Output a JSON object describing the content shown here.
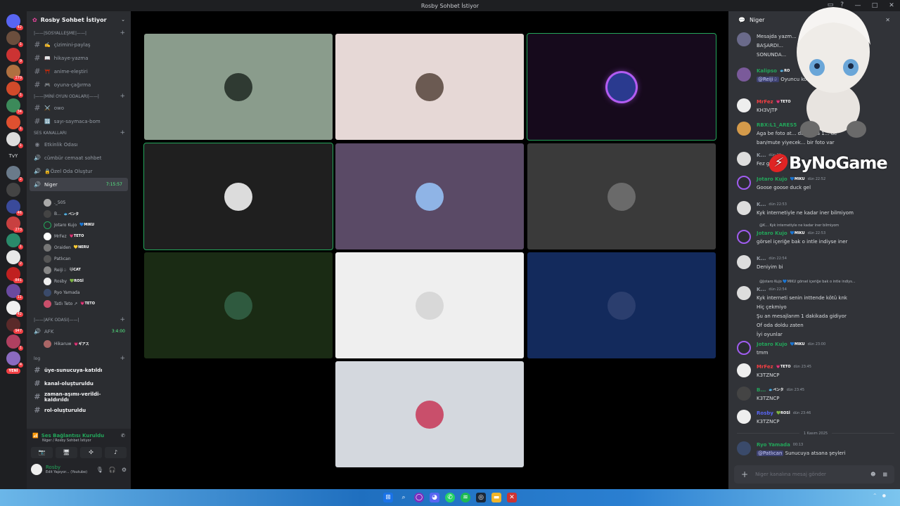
{
  "window": {
    "title": "Rosby Sohbet İstiyor",
    "controls": [
      "—",
      "□",
      "✕"
    ]
  },
  "rail": {
    "top_badge": "42",
    "new_badge": "YENİ",
    "text_server": "TvY",
    "badges": [
      "1",
      "9",
      "279",
      "1",
      "34",
      "1",
      "1",
      "2",
      "46",
      "273",
      "1",
      "2",
      "841",
      "11",
      "42",
      "947",
      "1",
      "4"
    ]
  },
  "guild": {
    "name": "Rosby Sohbet İstiyor"
  },
  "sidebar": {
    "cat1": "|——|SOSYALLEŞME|——|",
    "text_channels": [
      {
        "icon": "✍️",
        "label": "çizimini-paylaş"
      },
      {
        "icon": "📖",
        "label": "hikaye-yazma"
      },
      {
        "icon": "⛩️",
        "label": "anime-eleştiri"
      },
      {
        "icon": "🎮",
        "label": "oyuna-çağırma"
      }
    ],
    "cat2": "|——|MİNİ OYUN ODALARI|——|",
    "game_channels": [
      {
        "icon": "⚔️",
        "label": "owo"
      },
      {
        "icon": "🔢",
        "label": "sayı-saymaca-bom"
      }
    ],
    "cat3": "SES KANALLARI",
    "voice_channels": [
      {
        "label": "Etkinlik Odası"
      },
      {
        "label": "cümbür cemaat sohbet"
      },
      {
        "label": "🔒Özel Oda Oluştur"
      }
    ],
    "active_voice": {
      "label": "Niger",
      "time": "7:15:57"
    },
    "voice_users": [
      {
        "name": "._505",
        "tag": ""
      },
      {
        "name": "B...",
        "tag": "🐟ペンタ"
      },
      {
        "name": "Jotaro Kujo",
        "tag": "💙MIKU"
      },
      {
        "name": "MrFez",
        "tag": "💗TETO"
      },
      {
        "name": "Oraiden",
        "tag": "💛NERU"
      },
      {
        "name": "Patlıcan",
        "tag": ""
      },
      {
        "name": "Reiji♤",
        "tag": "🐱CAT"
      },
      {
        "name": "Rosby",
        "tag": "💚ROSİ"
      },
      {
        "name": "Ryo Yamada",
        "tag": ""
      },
      {
        "name": "Tatlı Teto ↗",
        "tag": "💗TETO"
      }
    ],
    "cat4": "|——|AFK ODASI|——|",
    "afk": {
      "label": "AFK",
      "time": "3:4:00"
    },
    "afk_user": {
      "name": "Hikaruw",
      "tag": "💗ギアス"
    },
    "cat5": "log",
    "log_channels": [
      "üye-sunucuya-katıldı",
      "kanal-oluşturuldu",
      "zaman-aşımı-verildi-kaldırıldı",
      "rol-oluşturuldu"
    ]
  },
  "voice_status": {
    "title": "Ses Bağlantısı Kuruldu",
    "sub": "Niger / Rosby Sohbet İstiyor"
  },
  "user": {
    "name": "Rosby",
    "status": "Edit Yapıyor... (Youtube)"
  },
  "grid": {
    "tiles": [
      {
        "bg": "#8a9c8c",
        "speak": false,
        "av": "#2f3a32"
      },
      {
        "bg": "#e6d8d6",
        "speak": false,
        "av": "#6b5a52"
      },
      {
        "bg": "#160a1c",
        "speak": true,
        "av": "#2a3a8f"
      },
      {
        "bg": "#1f1f1f",
        "speak": true,
        "av": "#dcdcdc"
      },
      {
        "bg": "#5a4a66",
        "speak": false,
        "av": "#8fb4e6"
      },
      {
        "bg": "#3a3a3a",
        "speak": false,
        "av": "#6a6a6a"
      },
      {
        "bg": "#1a2b14",
        "speak": false,
        "av": "#2f5a3f"
      },
      {
        "bg": "#efefef",
        "speak": false,
        "av": "#d8d8d8"
      },
      {
        "bg": "#132a5c",
        "speak": false,
        "av": "#2b3e6e"
      },
      {
        "bg": "#d4d8de",
        "speak": false,
        "av": "#c94f6b"
      }
    ]
  },
  "chat": {
    "channel": "Niger",
    "messages": [
      {
        "author": "",
        "color": "#f2f3f5",
        "tag": "",
        "time": "",
        "lines": [
          "Mesajda yazm...",
          "BAŞARDI...",
          "SONUNDA..."
        ]
      },
      {
        "author": "Kalipso",
        "color": "#23a55a",
        "tag": "🐟RO",
        "time": "",
        "lines": [
          "Oyuncu kodunu yo..."
        ],
        "mention": "@Reiji♤"
      },
      {
        "author": "MrFez",
        "color": "#f23f43",
        "tag": "💗TETO",
        "time": "",
        "lines": [
          "KH3VJTP"
        ]
      },
      {
        "author": "RBX:L1_ARES5",
        "color": "#23a55a",
        "tag": "",
        "time": "",
        "lines": [
          "Aga be foto at... da yoksa 1... de",
          "ban/mute yiyecek... bir foto var"
        ]
      },
      {
        "author": "K...",
        "color": "#949ba4",
        "tag": "",
        "time": "dün 22:...",
        "lines": [
          "Fez g..."
        ]
      },
      {
        "author": "Jotaro Kujo",
        "color": "#23a55a",
        "tag": "💙MIKU",
        "time": "dün 22:52",
        "lines": [
          "Goose goose duck gel"
        ]
      },
      {
        "author": "K...",
        "color": "#949ba4",
        "tag": "",
        "time": "dün 22:53",
        "lines": [
          "Kyk internetiyle ne kadar iner bilmiyom"
        ]
      },
      {
        "author": "Jotaro Kujo",
        "color": "#23a55a",
        "tag": "💙MIKU",
        "time": "dün 22:53",
        "lines": [
          "görsel içeriğe bak o intle indiyse iner"
        ],
        "reply": "@K... Kyk internetiyle ne kadar iner bilmiyom"
      },
      {
        "author": "K...",
        "color": "#949ba4",
        "tag": "",
        "time": "dün 22:54",
        "lines": [
          "Deniyim bi"
        ]
      },
      {
        "author": "K...",
        "color": "#949ba4",
        "tag": "",
        "time": "dün 22:54",
        "lines": [
          "Kyk interneti senin inttende kötü knk",
          "Hiç çekmiyo",
          "Şu an mesajlarım 1 dakikada gidiyor",
          "Of oda doldu zaten",
          "İyi oyunlar"
        ],
        "reply": "@Jotaro Kujo 💙MIKU görsel içeriğe bak o intle indiys..."
      },
      {
        "author": "Jotaro Kujo",
        "color": "#23a55a",
        "tag": "💙MIKU",
        "time": "dün 23:00",
        "lines": [
          "tmm"
        ]
      },
      {
        "author": "MrFez",
        "color": "#f23f43",
        "tag": "💗TETO",
        "time": "dün 23:45",
        "lines": [
          "K3TZNCP"
        ]
      },
      {
        "author": "B...",
        "color": "#23a55a",
        "tag": "🐟ペンタ",
        "time": "dün 23:45",
        "lines": [
          "K3TZNCP"
        ]
      },
      {
        "author": "Rosby",
        "color": "#5865f2",
        "tag": "💚ROSİ",
        "time": "dün 23:46",
        "lines": [
          "K3TZNCP"
        ]
      },
      {
        "author": "Ryo Yamada",
        "color": "#23a55a",
        "tag": "",
        "time": "00:13",
        "lines": [
          "Sunucuya atsana şeyleri"
        ],
        "mention": "@Patlıcan"
      }
    ],
    "date_separator": "1 Kasım 2025",
    "composer_placeholder": "Niger kanalına mesaj gönder"
  },
  "overlay": {
    "logo_text": "ByNoGame"
  },
  "taskbar": {
    "icons": [
      "start-icon",
      "search-icon",
      "browser-icon",
      "discord-icon",
      "whatsapp-icon",
      "spotify-icon",
      "steam-icon",
      "folder-icon",
      "game-icon"
    ]
  }
}
